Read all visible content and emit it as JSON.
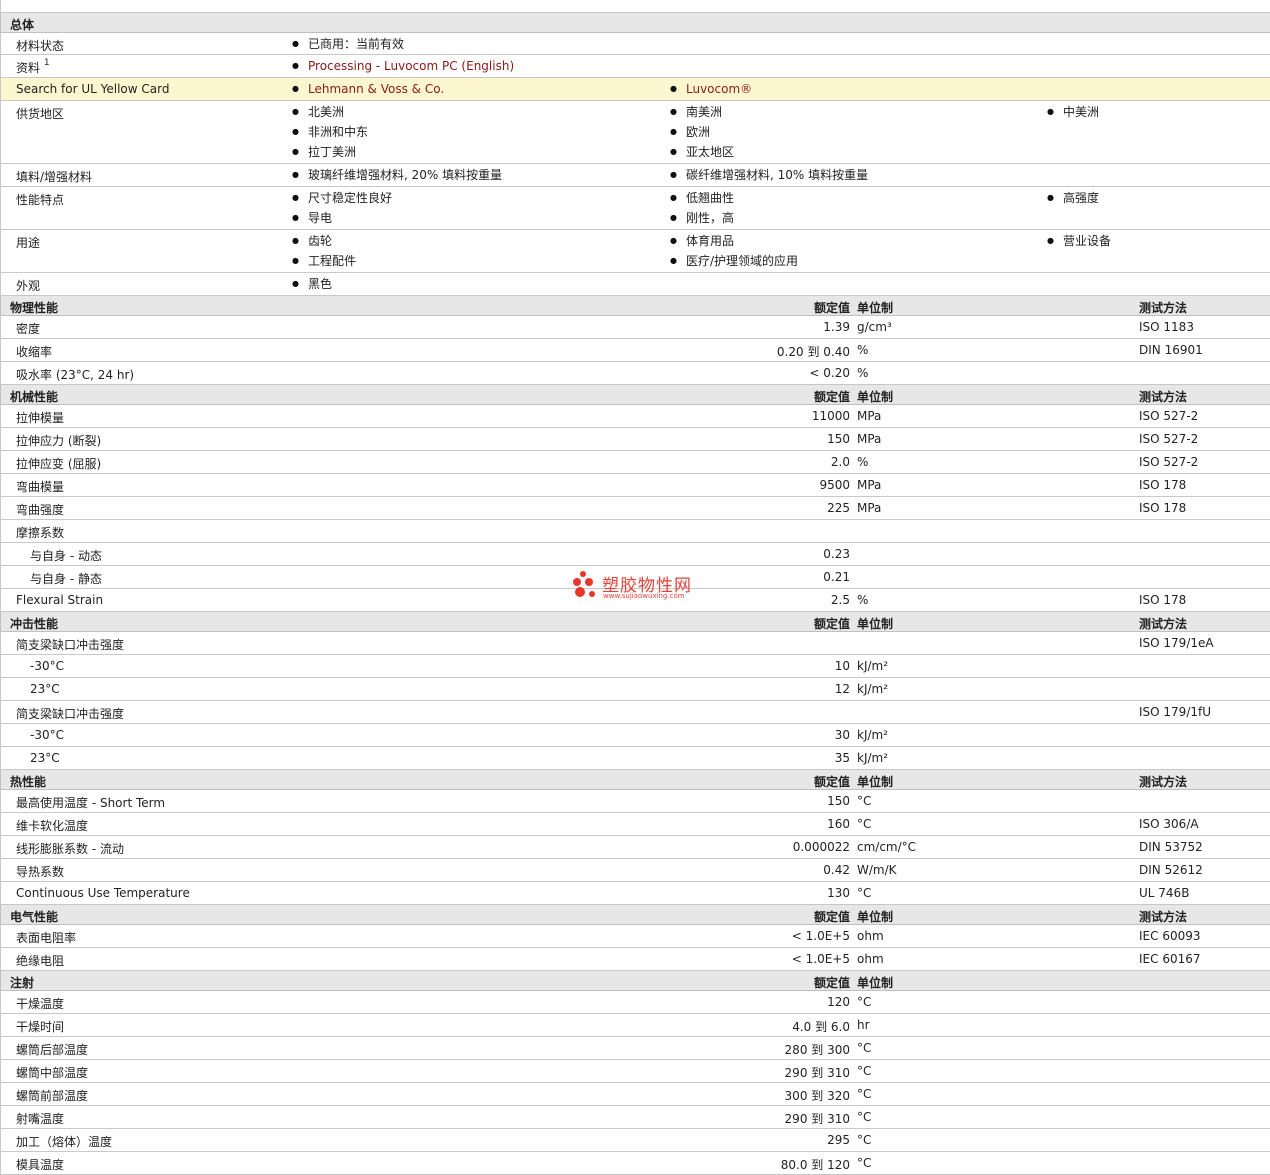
{
  "overview": {
    "title": "总体",
    "material_status": {
      "label": "材料状态",
      "value": "已商用：当前有效"
    },
    "documents": {
      "label": "资料",
      "sup": "1",
      "link": "Processing - Luvocom PC (English)"
    },
    "ul_card": {
      "label": "Search for UL Yellow Card",
      "links": [
        "Lehmann & Voss & Co.",
        "Luvocom®"
      ]
    },
    "supply": {
      "label": "供货地区",
      "col1": [
        "北美洲",
        "非洲和中东",
        "拉丁美洲"
      ],
      "col2": [
        "南美洲",
        "欧洲",
        "亚太地区"
      ],
      "col3": [
        "中美洲"
      ]
    },
    "filler": {
      "label": "填料/增强材料",
      "col1": [
        "玻璃纤维增强材料, 20% 填料按重量"
      ],
      "col2": [
        "碳纤维增强材料, 10% 填料按重量"
      ]
    },
    "features": {
      "label": "性能特点",
      "col1": [
        "尺寸稳定性良好",
        "导电"
      ],
      "col2": [
        "低翘曲性",
        "刚性，高"
      ],
      "col3": [
        "高强度"
      ]
    },
    "uses": {
      "label": "用途",
      "col1": [
        "齿轮",
        "工程配件"
      ],
      "col2": [
        "体育用品",
        "医疗/护理领域的应用"
      ],
      "col3": [
        "营业设备"
      ]
    },
    "appearance": {
      "label": "外观",
      "col1": [
        "黑色"
      ]
    }
  },
  "headers": {
    "value": "额定值",
    "unit": "单位制",
    "test": "测试方法"
  },
  "physical": {
    "title": "物理性能",
    "rows": [
      {
        "label": "密度",
        "value": "1.39",
        "unit": "g/cm³",
        "test": "ISO 1183"
      },
      {
        "label": "收缩率",
        "value": "0.20 到  0.40",
        "unit": "%",
        "test": "DIN 16901"
      },
      {
        "label": "吸水率  (23°C, 24 hr)",
        "value": "< 0.20",
        "unit": "%",
        "test": ""
      }
    ]
  },
  "mechanical": {
    "title": "机械性能",
    "rows": [
      {
        "label": "拉伸模量",
        "value": "11000",
        "unit": "MPa",
        "test": "ISO 527-2"
      },
      {
        "label": "拉伸应力  (断裂)",
        "value": "150",
        "unit": "MPa",
        "test": "ISO 527-2"
      },
      {
        "label": "拉伸应变  (屈服)",
        "value": "2.0",
        "unit": "%",
        "test": "ISO 527-2"
      },
      {
        "label": "弯曲模量",
        "value": "9500",
        "unit": "MPa",
        "test": "ISO 178"
      },
      {
        "label": "弯曲强度",
        "value": "225",
        "unit": "MPa",
        "test": "ISO 178"
      },
      {
        "label": "摩擦系数",
        "value": "",
        "unit": "",
        "test": ""
      },
      {
        "label": "与自身  - 动态",
        "value": "0.23",
        "unit": "",
        "test": "",
        "sub": true
      },
      {
        "label": "与自身  - 静态",
        "value": "0.21",
        "unit": "",
        "test": "",
        "sub": true
      },
      {
        "label": "Flexural Strain",
        "value": "2.5",
        "unit": "%",
        "test": "ISO 178"
      }
    ]
  },
  "impact": {
    "title": "冲击性能",
    "rows": [
      {
        "label": "简支梁缺口冲击强度",
        "value": "",
        "unit": "",
        "test": "ISO 179/1eA"
      },
      {
        "label": "-30°C",
        "value": "10",
        "unit": "kJ/m²",
        "test": "",
        "sub": true
      },
      {
        "label": "23°C",
        "value": "12",
        "unit": "kJ/m²",
        "test": "",
        "sub": true
      },
      {
        "label": "简支梁缺口冲击强度",
        "value": "",
        "unit": "",
        "test": "ISO 179/1fU"
      },
      {
        "label": "-30°C",
        "value": "30",
        "unit": "kJ/m²",
        "test": "",
        "sub": true
      },
      {
        "label": "23°C",
        "value": "35",
        "unit": "kJ/m²",
        "test": "",
        "sub": true
      }
    ]
  },
  "thermal": {
    "title": "热性能",
    "rows": [
      {
        "label": "最高使用温度  - Short Term",
        "value": "150",
        "unit": "°C",
        "test": ""
      },
      {
        "label": "维卡软化温度",
        "value": "160",
        "unit": "°C",
        "test": "ISO 306/A"
      },
      {
        "label": "线形膨胀系数  - 流动",
        "value": "0.000022",
        "unit": "cm/cm/°C",
        "test": "DIN 53752"
      },
      {
        "label": "导热系数",
        "value": "0.42",
        "unit": "W/m/K",
        "test": "DIN 52612"
      },
      {
        "label": "Continuous Use Temperature",
        "value": "130",
        "unit": "°C",
        "test": "UL 746B"
      }
    ]
  },
  "electrical": {
    "title": "电气性能",
    "rows": [
      {
        "label": "表面电阻率",
        "value": "< 1.0E+5",
        "unit": "ohm",
        "test": "IEC 60093"
      },
      {
        "label": "绝缘电阻",
        "value": "< 1.0E+5",
        "unit": "ohm",
        "test": "IEC 60167"
      }
    ]
  },
  "injection": {
    "title": "注射",
    "rows": [
      {
        "label": "干燥温度",
        "value": "120",
        "unit": "°C",
        "test": ""
      },
      {
        "label": "干燥时间",
        "value": "4.0 到  6.0",
        "unit": "hr",
        "test": ""
      },
      {
        "label": "螺筒后部温度",
        "value": "280 到  300",
        "unit": "°C",
        "test": ""
      },
      {
        "label": "螺筒中部温度",
        "value": "290 到  310",
        "unit": "°C",
        "test": ""
      },
      {
        "label": "螺筒前部温度",
        "value": "300 到  320",
        "unit": "°C",
        "test": ""
      },
      {
        "label": "射嘴温度",
        "value": "290 到  310",
        "unit": "°C",
        "test": ""
      },
      {
        "label": "加工（熔体）温度",
        "value": "295",
        "unit": "°C",
        "test": ""
      },
      {
        "label": "模具温度",
        "value": "80.0 到  120",
        "unit": "°C",
        "test": ""
      }
    ]
  },
  "watermark": {
    "text": "塑胶物性网",
    "url": "www.sujiaowuxing.com"
  }
}
